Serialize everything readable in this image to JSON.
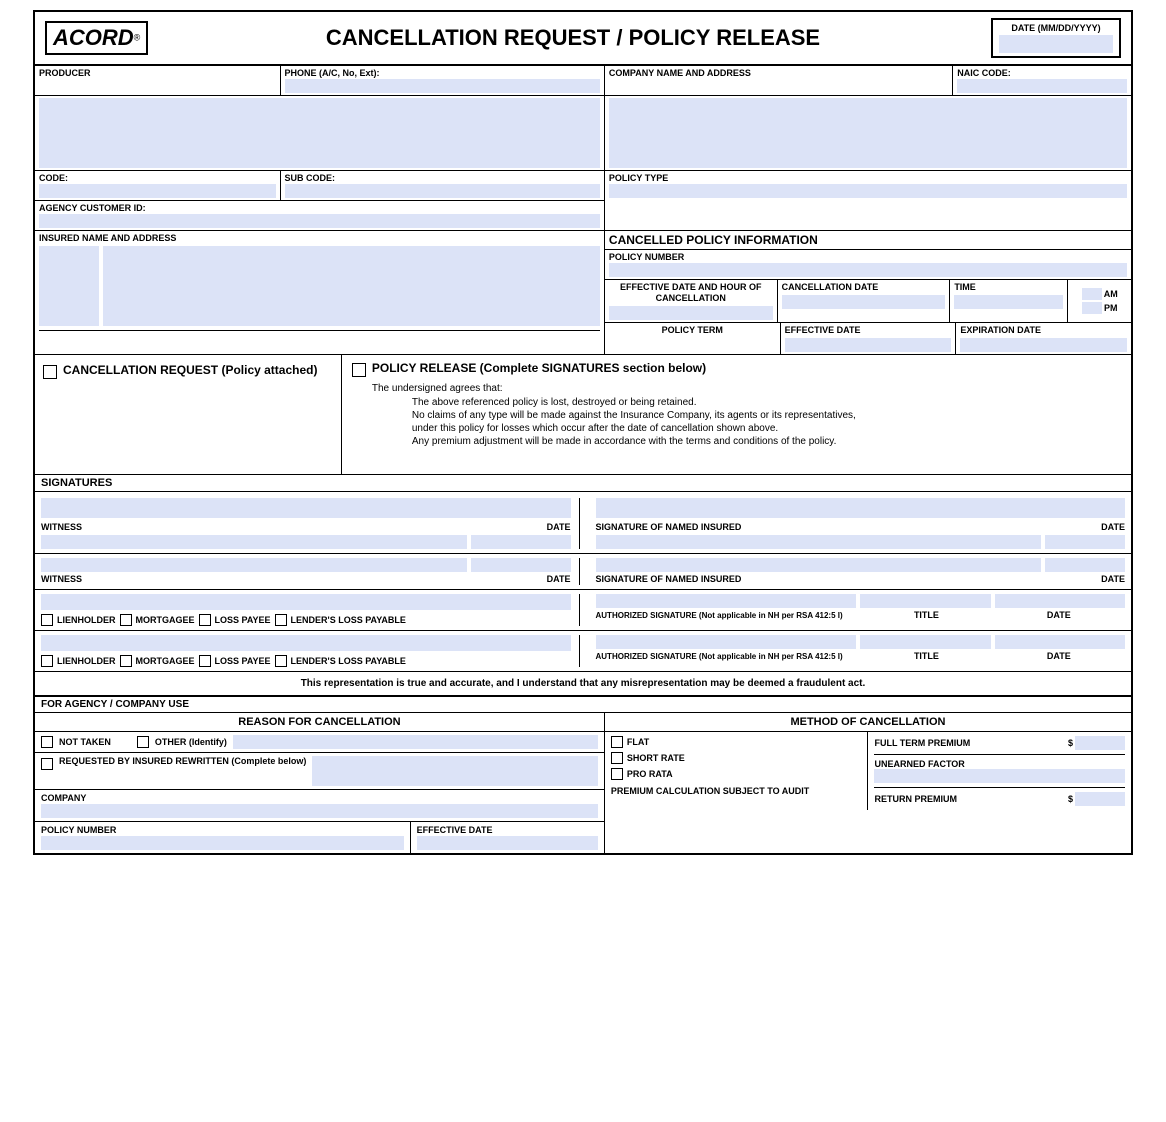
{
  "header": {
    "logo": "ACORD",
    "title": "CANCELLATION REQUEST / POLICY RELEASE",
    "date_label": "DATE (MM/DD/YYYY)"
  },
  "form": {
    "producer_label": "PRODUCER",
    "phone_label": "PHONE (A/C, No, Ext):",
    "company_label": "COMPANY NAME AND ADDRESS",
    "naic_label": "NAIC CODE:",
    "code_label": "CODE:",
    "subcode_label": "SUB CODE:",
    "policy_type_label": "POLICY TYPE",
    "agency_id_label": "AGENCY CUSTOMER ID:",
    "insured_label": "INSURED NAME AND ADDRESS",
    "cancelled_policy_label": "CANCELLED POLICY INFORMATION",
    "policy_number_label": "POLICY NUMBER",
    "effective_date_hour_label": "EFFECTIVE DATE AND HOUR OF CANCELLATION",
    "cancellation_date_label": "CANCELLATION DATE",
    "time_label": "TIME",
    "am_label": "AM",
    "pm_label": "PM",
    "policy_term_label": "POLICY TERM",
    "effective_date_label": "EFFECTIVE DATE",
    "expiration_date_label": "EXPIRATION DATE",
    "cancellation_request_label": "CANCELLATION REQUEST (Policy attached)",
    "policy_release_label": "POLICY RELEASE (Complete SIGNATURES section below)",
    "undersigned_text": "The undersigned agrees that:",
    "line1": "The above referenced policy is lost, destroyed or being retained.",
    "line2": "No claims of any type will be made against the Insurance Company, its agents or its representatives,",
    "line3": "under this policy for losses which occur after the date of cancellation shown above.",
    "line4": "Any premium adjustment will be made in accordance with the terms and conditions of the policy.",
    "signatures_label": "SIGNATURES",
    "witness_label": "WITNESS",
    "date_label2": "DATE",
    "sig_named_insured_label": "SIGNATURE OF NAMED INSURED",
    "witness_label2": "WITNESS",
    "date_label3": "DATE",
    "sig_named_insured_label2": "SIGNATURE OF NAMED INSURED",
    "date_label4": "DATE",
    "lienholder_label": "LIENHOLDER",
    "mortgagee_label": "MORTGAGEE",
    "loss_payee_label": "LOSS PAYEE",
    "lenders_loss_label": "LENDER'S LOSS PAYABLE",
    "auth_sig_label": "AUTHORIZED SIGNATURE (Not applicable in NH per RSA 412:5 I)",
    "title_label": "TITLE",
    "date_label5": "DATE",
    "auth_sig_label2": "AUTHORIZED SIGNATURE (Not applicable in NH per RSA 412:5 I)",
    "title_label2": "TITLE",
    "date_label6": "DATE",
    "fraud_text": "This representation is true and accurate, and I understand that any misrepresentation may be deemed a fraudulent act.",
    "for_agency_label": "FOR AGENCY / COMPANY USE",
    "reason_cancellation_label": "REASON FOR CANCELLATION",
    "method_cancellation_label": "METHOD OF CANCELLATION",
    "not_taken_label": "NOT TAKEN",
    "other_label": "OTHER (Identify)",
    "requested_label": "REQUESTED BY INSURED REWRITTEN (Complete below)",
    "company_label2": "COMPANY",
    "policy_number_label2": "POLICY NUMBER",
    "effective_date_label2": "EFFECTIVE DATE",
    "flat_label": "FLAT",
    "short_rate_label": "SHORT RATE",
    "pro_rata_label": "PRO RATA",
    "premium_calc_label": "PREMIUM CALCULATION SUBJECT TO AUDIT",
    "full_term_label": "FULL TERM PREMIUM",
    "dollar1": "$",
    "unearned_label": "UNEARNED FACTOR",
    "return_premium_label": "RETURN PREMIUM",
    "dollar2": "$"
  }
}
